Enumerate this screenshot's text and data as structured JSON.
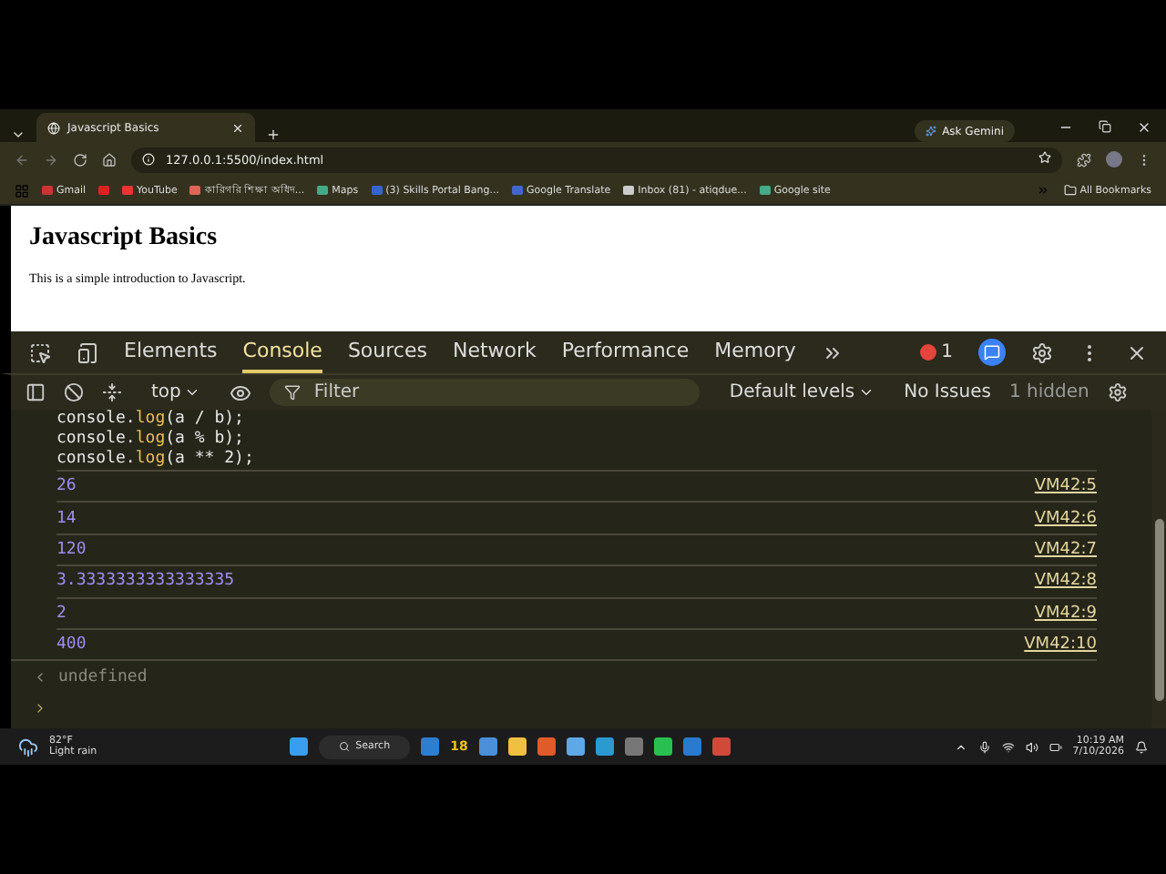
{
  "browser_tabs": [
    {
      "title": "Javascript Basics",
      "selected": true
    }
  ],
  "ask_gemini": "Ask Gemini",
  "address": "127.0.0.1:5500/index.html",
  "bookmarks": [
    "Gmail",
    "YouTube",
    "কারিগরি শিক্ষা অধিদ...",
    "Maps",
    "(3) Skills Portal Bang...",
    "Google Translate",
    "Inbox (81) - atiqdue...",
    "Google site"
  ],
  "all_bookmarks": "All Bookmarks",
  "page": {
    "heading": "Javascript Basics",
    "paragraph": "This is a simple introduction to Javascript."
  },
  "devtools": {
    "tabs": [
      {
        "label": "Elements",
        "selected": false
      },
      {
        "label": "Console",
        "selected": true
      },
      {
        "label": "Sources",
        "selected": false
      },
      {
        "label": "Network",
        "selected": false
      },
      {
        "label": "Performance",
        "selected": false
      },
      {
        "label": "Memory",
        "selected": false
      }
    ],
    "error_count": "1",
    "context": "top",
    "filter_placeholder": "Filter",
    "levels": "Default levels",
    "issues": "No Issues",
    "hidden": "1 hidden"
  },
  "console": {
    "code_lines": [
      {
        "object": "console.",
        "method": "log",
        "args": "(a / b);"
      },
      {
        "object": "console.",
        "method": "log",
        "args": "(a % b);"
      },
      {
        "object": "console.",
        "method": "log",
        "args": "(a ** 2);"
      }
    ],
    "outputs": [
      {
        "value": "26",
        "source": "VM42:5"
      },
      {
        "value": "14",
        "source": "VM42:6"
      },
      {
        "value": "120",
        "source": "VM42:7"
      },
      {
        "value": "3.3333333333333335",
        "source": "VM42:8"
      },
      {
        "value": "2",
        "source": "VM42:9"
      },
      {
        "value": "400",
        "source": "VM42:10"
      }
    ],
    "result": "undefined"
  },
  "taskbar": {
    "temperature": "82°F",
    "weather": "Light rain",
    "search": "Search",
    "badge": "18",
    "time": "10:19 AM",
    "date": "7/10/2026"
  }
}
